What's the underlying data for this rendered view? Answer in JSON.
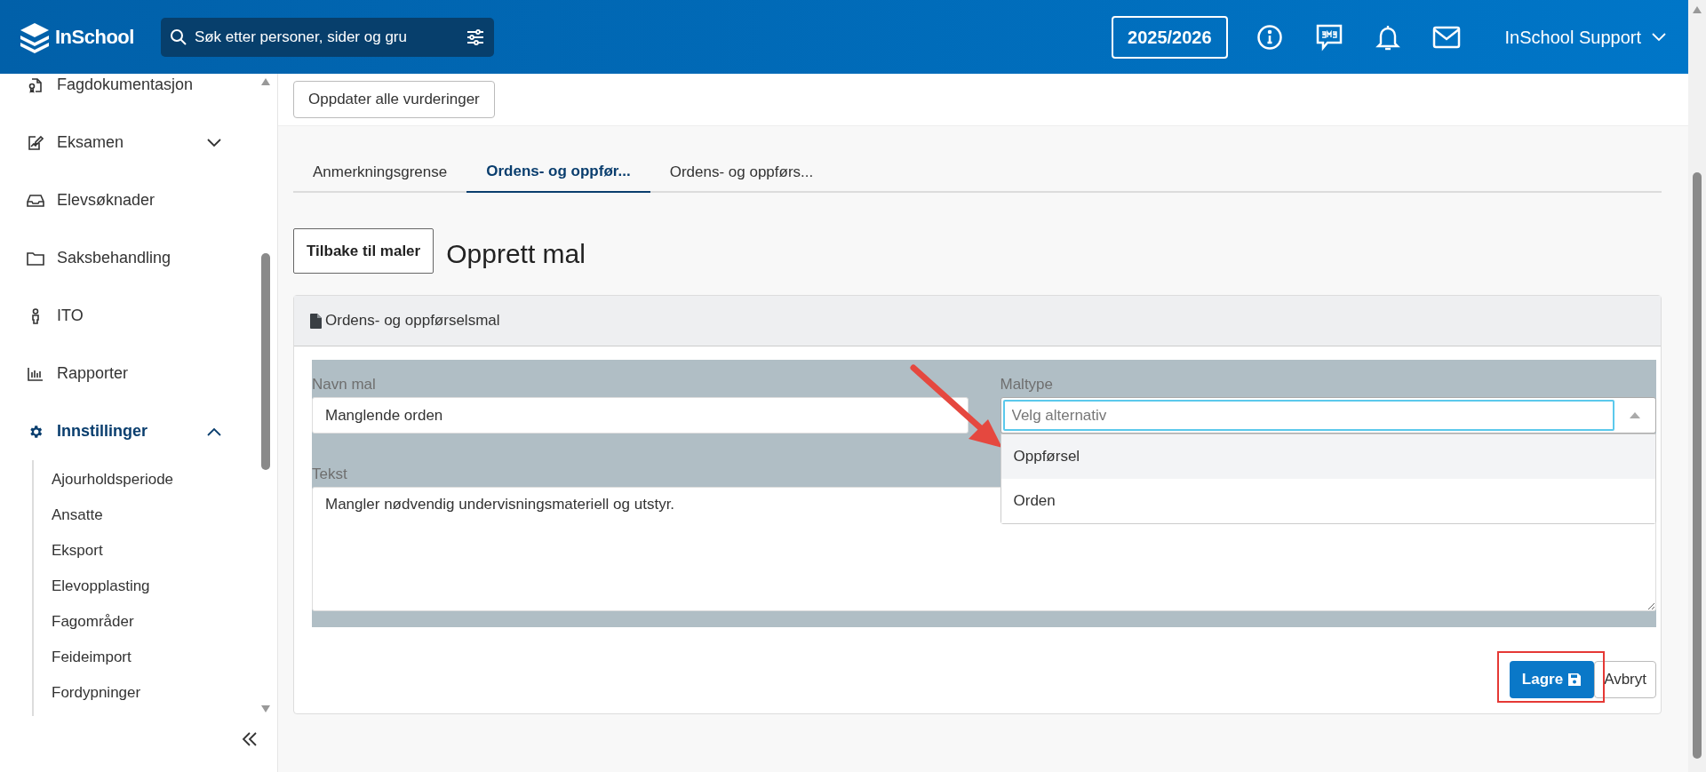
{
  "header": {
    "logo": "InSchool",
    "search": {
      "placeholder": "Søk etter personer, sider og gru"
    },
    "school_year": "2025/2026",
    "user": "InSchool Support"
  },
  "sidebar": {
    "items": [
      {
        "label": "Fagdokumentasjon",
        "selected": false
      },
      {
        "label": "Eksamen",
        "selected": false,
        "expanded": false
      },
      {
        "label": "Elevsøknader",
        "selected": false
      },
      {
        "label": "Saksbehandling",
        "selected": false
      },
      {
        "label": "ITO",
        "selected": false
      },
      {
        "label": "Rapporter",
        "selected": false
      },
      {
        "label": "Innstillinger",
        "selected": true,
        "expanded": true,
        "children": [
          {
            "label": "Ajourholdsperiode",
            "selected": false
          },
          {
            "label": "Ansatte",
            "selected": false
          },
          {
            "label": "Eksport",
            "selected": false
          },
          {
            "label": "Elevopplasting",
            "selected": false
          },
          {
            "label": "Fagområder",
            "selected": false
          },
          {
            "label": "Feideimport",
            "selected": false
          },
          {
            "label": "Fordypninger",
            "selected": false
          }
        ]
      }
    ]
  },
  "toolbar": {
    "button": "Oppdater alle vurderinger"
  },
  "tabs": [
    {
      "label": "Anmerkningsgrense",
      "selected": false
    },
    {
      "label": "Ordens- og oppfør...",
      "selected": true
    },
    {
      "label": "Ordens- og oppførs...",
      "selected": false
    }
  ],
  "back_button": "Tilbake til maler",
  "title": "Opprett mal",
  "card": {
    "title": "Ordens- og oppførselsmal",
    "form_rows": [
      {
        "fields": [
          {
            "kind": "text",
            "label": "Navn mal",
            "value": "Manglende orden"
          },
          {
            "kind": "select",
            "label": "Maltype",
            "placeholder": "Velg alternativ",
            "expanded": true,
            "options": [
              {
                "label": "Oppførsel",
                "selected": true
              },
              {
                "label": "Orden",
                "selected": false
              }
            ]
          }
        ]
      },
      {
        "fields": [
          {
            "kind": "textarea",
            "label": "Tekst",
            "value": "Mangler nødvendig undervisningsmateriell og utstyr."
          }
        ]
      }
    ],
    "buttons": [
      {
        "kind": "primary",
        "label": "Lagre"
      },
      {
        "kind": "secondary",
        "label": "Avbryt"
      }
    ]
  },
  "annotations": {
    "arrow": true,
    "highlight": true
  }
}
